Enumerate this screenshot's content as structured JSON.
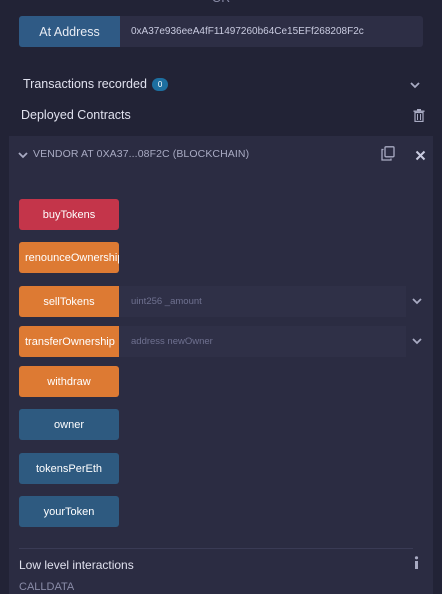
{
  "top_cut_text": "OR",
  "at_address": {
    "button_label": "At Address",
    "address_value": "0xA37e936eeA4fF11497260b64Ce15EFf268208F2c"
  },
  "transactions": {
    "label": "Transactions recorded",
    "count": "0"
  },
  "deployed": {
    "label": "Deployed Contracts"
  },
  "instance": {
    "title": "VENDOR AT 0XA37...08F2C (BLOCKCHAIN)",
    "functions": [
      {
        "label": "buyTokens"
      },
      {
        "label": "renounceOwnership"
      },
      {
        "label": "sellTokens",
        "placeholder": "uint256 _amount"
      },
      {
        "label": "transferOwnership",
        "placeholder": "address newOwner"
      },
      {
        "label": "withdraw"
      },
      {
        "label": "owner"
      },
      {
        "label": "tokensPerEth"
      },
      {
        "label": "yourToken"
      }
    ]
  },
  "low_level": {
    "label": "Low level interactions",
    "calldata_label": "CALLDATA"
  },
  "colors": {
    "payable": "#c4354a",
    "nonpayable": "#dd7a33",
    "view": "#2e5a80"
  }
}
